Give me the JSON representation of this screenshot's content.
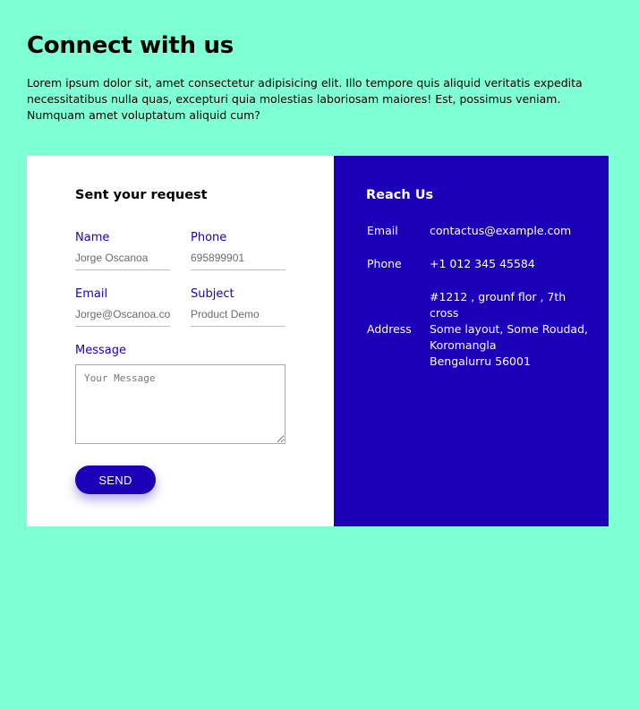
{
  "header": {
    "title": "Connect with us",
    "intro": "Lorem ipsum dolor sit, amet consectetur adipisicing elit. Illo tempore quis aliquid veritatis expedita necessitatibus nulla quas, excepturi quia molestias laboriosam maiores! Est, possimus veniam. Numquam amet voluptatum aliquid cum?"
  },
  "form": {
    "title": "Sent your request",
    "name_label": "Name",
    "name_placeholder": "Jorge Oscanoa",
    "phone_label": "Phone",
    "phone_placeholder": "695899901",
    "email_label": "Email",
    "email_placeholder": "Jorge@Oscanoa.com",
    "subject_label": "Subject",
    "subject_placeholder": "Product Demo",
    "message_label": "Message",
    "message_placeholder": "Your Message",
    "send_label": "SEND"
  },
  "info": {
    "title": "Reach Us",
    "email_label": "Email",
    "email_value": "contactus@example.com",
    "phone_label": "Phone",
    "phone_value": "+1 012 345 45584",
    "address_label": "Address",
    "address_lines": [
      "#1212 , grounf flor , 7th cross",
      "Some layout, Some Roudad, Koromangla",
      "Bengalurru 56001"
    ]
  },
  "colors": {
    "background": "#7fffd4",
    "accent": "#1b00b8",
    "card": "#ffffff"
  }
}
